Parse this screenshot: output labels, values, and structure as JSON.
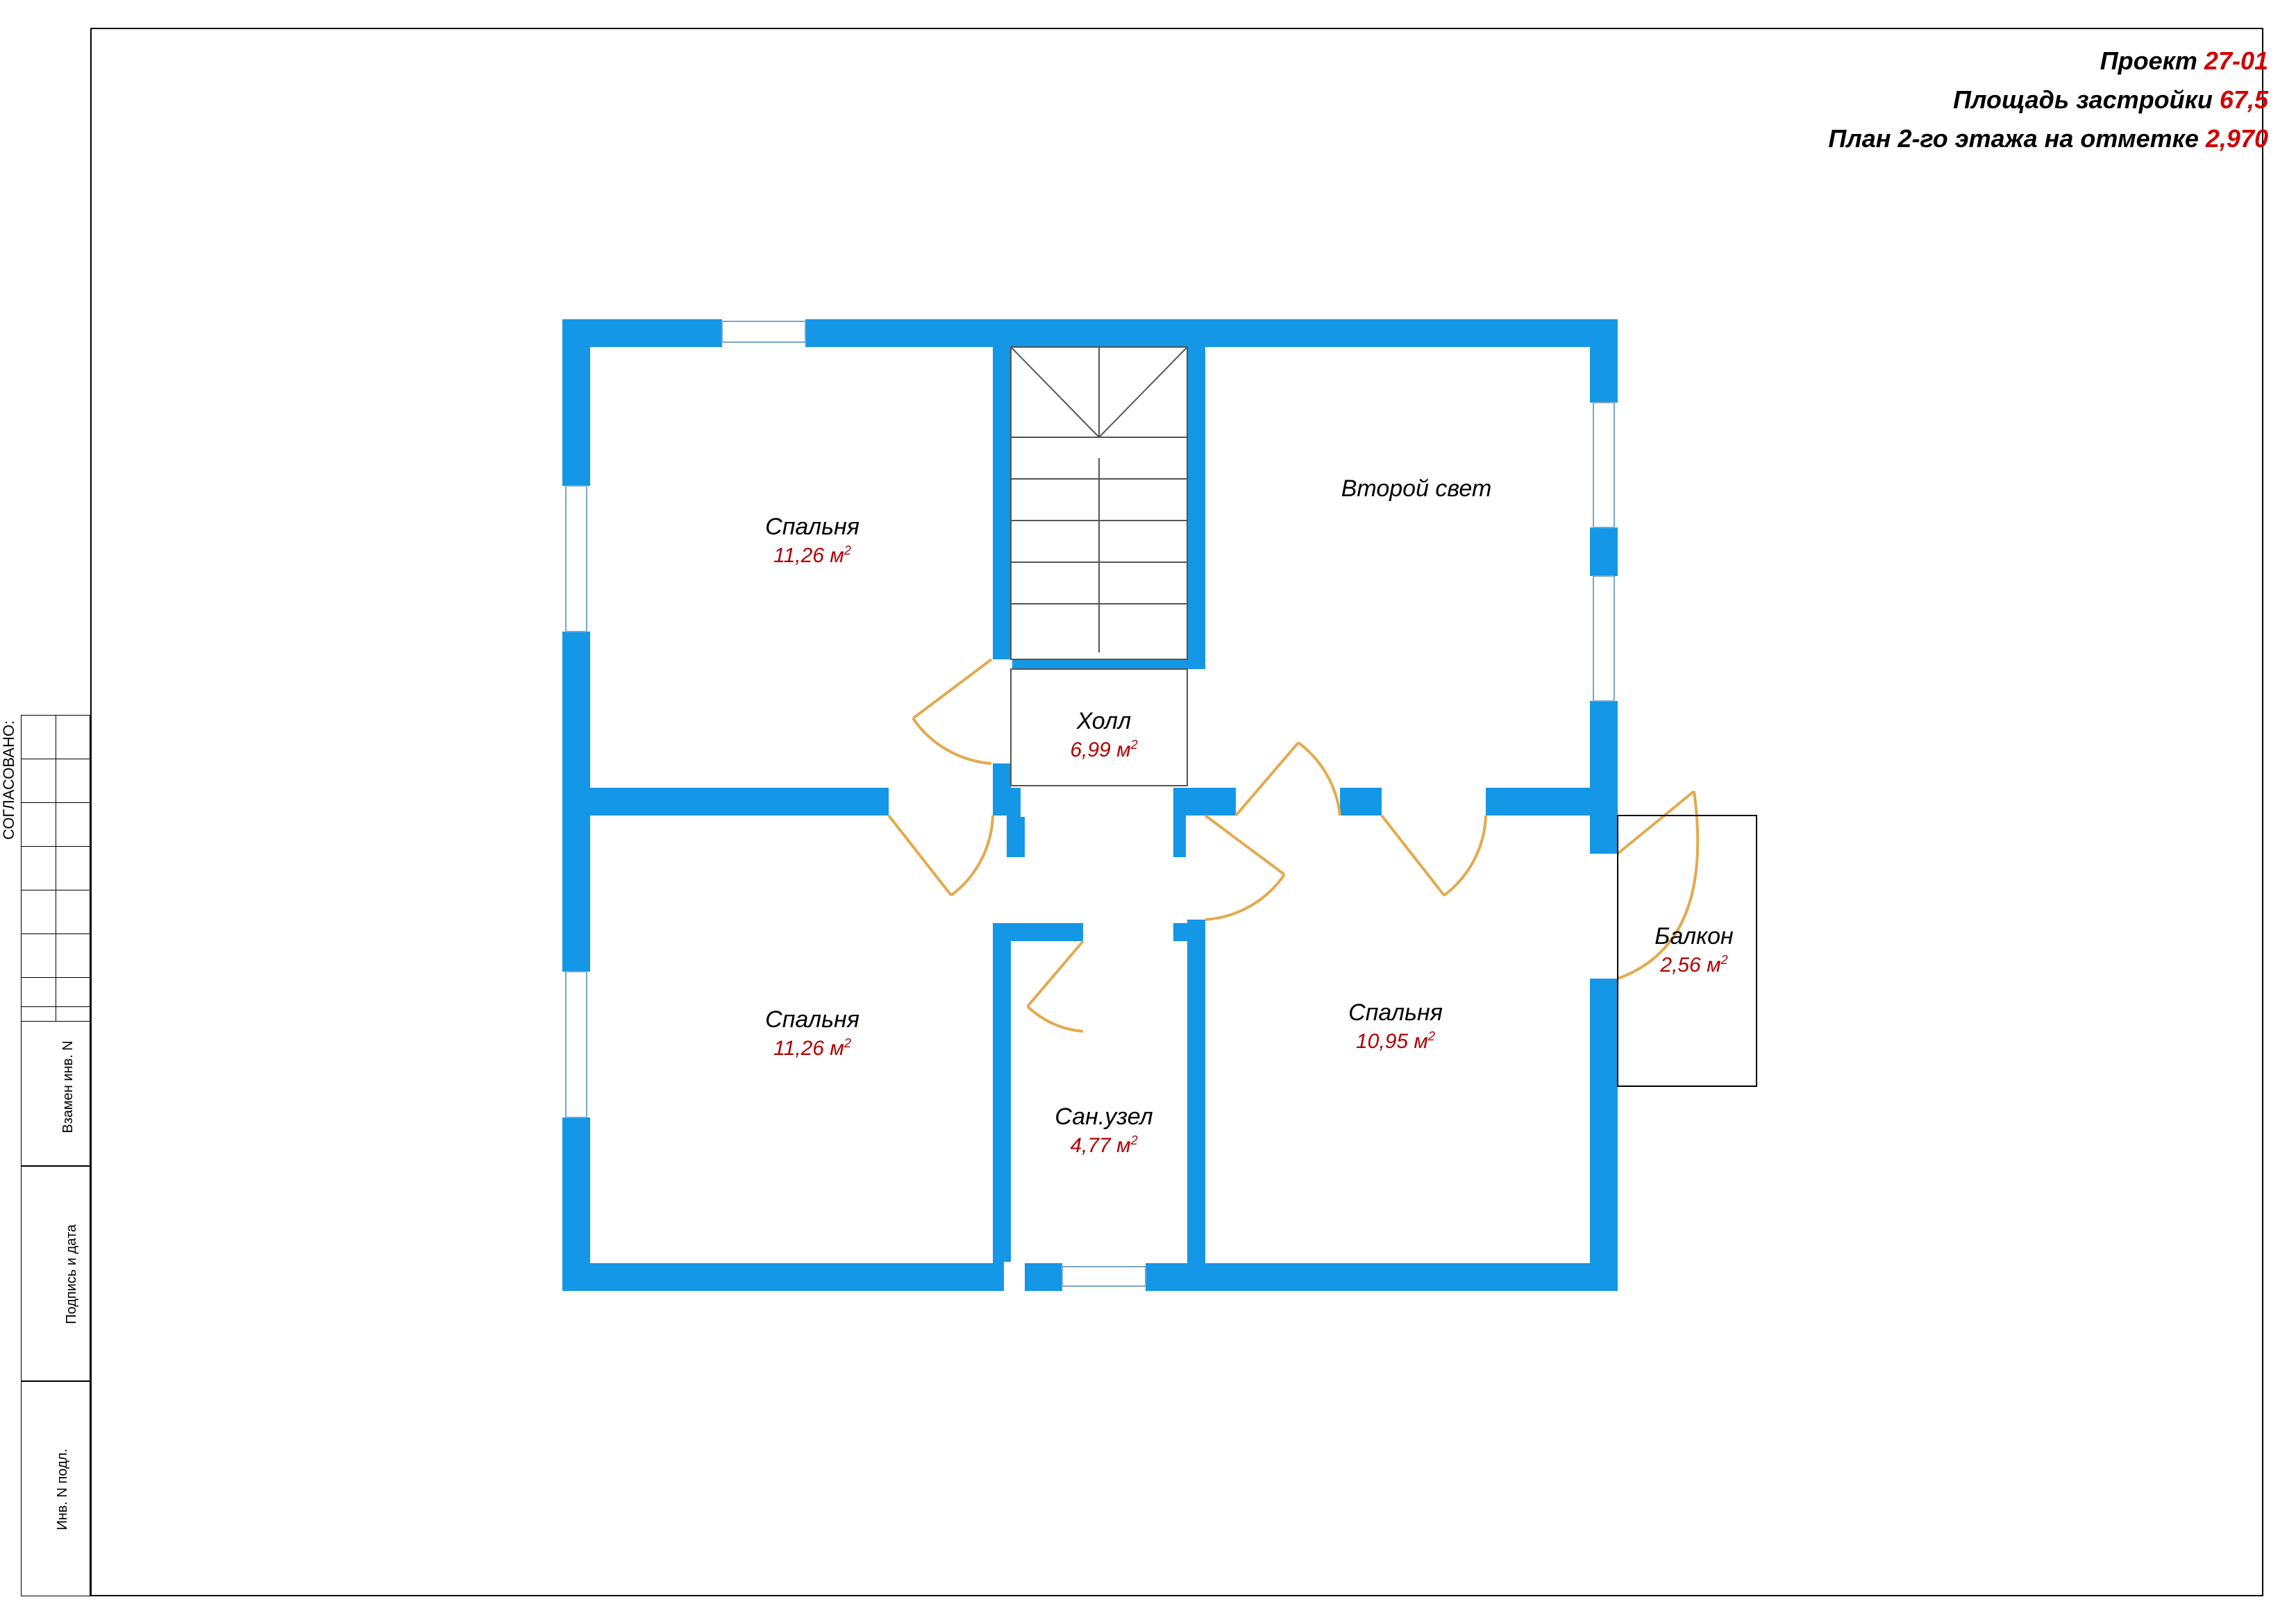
{
  "header": {
    "project_label": "Проект",
    "project_number": "27-01",
    "area_label": "Площадь застройки",
    "area_value": "67,5",
    "title_label": "План 2-го этажа на отметке",
    "title_value": "2,970"
  },
  "side": {
    "agreed": "СОГЛАСОВАНО:",
    "l1": "Взамен инв. N",
    "l2": "Подпись и дата",
    "l3": "Инв. N подл."
  },
  "rooms": {
    "bedroom1": {
      "name": "Спальня",
      "area": "11,26 м",
      "sup": "2"
    },
    "bedroom2": {
      "name": "Спальня",
      "area": "11,26 м",
      "sup": "2"
    },
    "bedroom3": {
      "name": "Спальня",
      "area": "10,95 м",
      "sup": "2"
    },
    "hall": {
      "name": "Холл",
      "area": "6,99 м",
      "sup": "2"
    },
    "bath": {
      "name": "Сан.узел",
      "area": "4,77 м",
      "sup": "2"
    },
    "secondlight": {
      "name": "Второй свет",
      "area": "",
      "sup": ""
    },
    "balcony": {
      "name": "Балкон",
      "area": "2,56 м",
      "sup": "2"
    }
  },
  "colors": {
    "wall": "#1497e6",
    "door": "#e2aa4e",
    "dim_red": "#b00000"
  }
}
